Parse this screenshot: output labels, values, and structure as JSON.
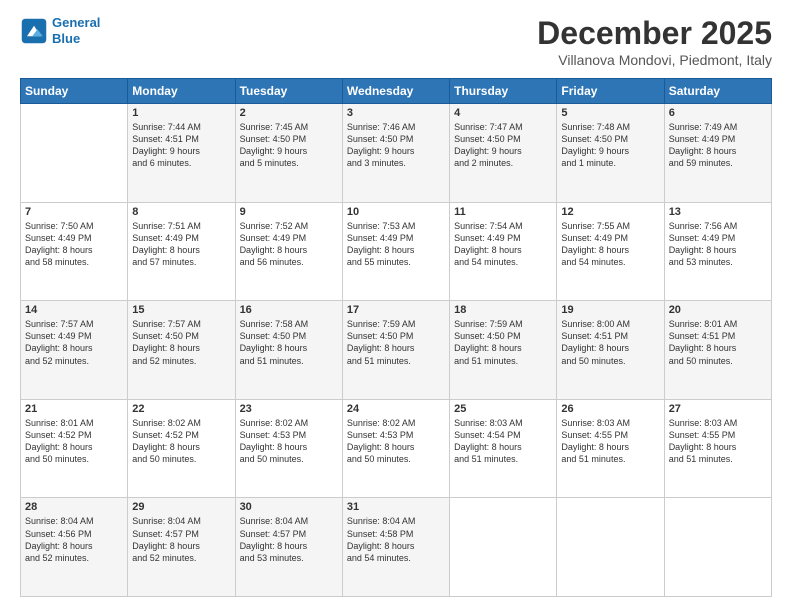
{
  "header": {
    "logo_line1": "General",
    "logo_line2": "Blue",
    "month": "December 2025",
    "location": "Villanova Mondovi, Piedmont, Italy"
  },
  "days_of_week": [
    "Sunday",
    "Monday",
    "Tuesday",
    "Wednesday",
    "Thursday",
    "Friday",
    "Saturday"
  ],
  "weeks": [
    [
      {
        "day": "",
        "content": ""
      },
      {
        "day": "1",
        "content": "Sunrise: 7:44 AM\nSunset: 4:51 PM\nDaylight: 9 hours\nand 6 minutes."
      },
      {
        "day": "2",
        "content": "Sunrise: 7:45 AM\nSunset: 4:50 PM\nDaylight: 9 hours\nand 5 minutes."
      },
      {
        "day": "3",
        "content": "Sunrise: 7:46 AM\nSunset: 4:50 PM\nDaylight: 9 hours\nand 3 minutes."
      },
      {
        "day": "4",
        "content": "Sunrise: 7:47 AM\nSunset: 4:50 PM\nDaylight: 9 hours\nand 2 minutes."
      },
      {
        "day": "5",
        "content": "Sunrise: 7:48 AM\nSunset: 4:50 PM\nDaylight: 9 hours\nand 1 minute."
      },
      {
        "day": "6",
        "content": "Sunrise: 7:49 AM\nSunset: 4:49 PM\nDaylight: 8 hours\nand 59 minutes."
      }
    ],
    [
      {
        "day": "7",
        "content": "Sunrise: 7:50 AM\nSunset: 4:49 PM\nDaylight: 8 hours\nand 58 minutes."
      },
      {
        "day": "8",
        "content": "Sunrise: 7:51 AM\nSunset: 4:49 PM\nDaylight: 8 hours\nand 57 minutes."
      },
      {
        "day": "9",
        "content": "Sunrise: 7:52 AM\nSunset: 4:49 PM\nDaylight: 8 hours\nand 56 minutes."
      },
      {
        "day": "10",
        "content": "Sunrise: 7:53 AM\nSunset: 4:49 PM\nDaylight: 8 hours\nand 55 minutes."
      },
      {
        "day": "11",
        "content": "Sunrise: 7:54 AM\nSunset: 4:49 PM\nDaylight: 8 hours\nand 54 minutes."
      },
      {
        "day": "12",
        "content": "Sunrise: 7:55 AM\nSunset: 4:49 PM\nDaylight: 8 hours\nand 54 minutes."
      },
      {
        "day": "13",
        "content": "Sunrise: 7:56 AM\nSunset: 4:49 PM\nDaylight: 8 hours\nand 53 minutes."
      }
    ],
    [
      {
        "day": "14",
        "content": "Sunrise: 7:57 AM\nSunset: 4:49 PM\nDaylight: 8 hours\nand 52 minutes."
      },
      {
        "day": "15",
        "content": "Sunrise: 7:57 AM\nSunset: 4:50 PM\nDaylight: 8 hours\nand 52 minutes."
      },
      {
        "day": "16",
        "content": "Sunrise: 7:58 AM\nSunset: 4:50 PM\nDaylight: 8 hours\nand 51 minutes."
      },
      {
        "day": "17",
        "content": "Sunrise: 7:59 AM\nSunset: 4:50 PM\nDaylight: 8 hours\nand 51 minutes."
      },
      {
        "day": "18",
        "content": "Sunrise: 7:59 AM\nSunset: 4:50 PM\nDaylight: 8 hours\nand 51 minutes."
      },
      {
        "day": "19",
        "content": "Sunrise: 8:00 AM\nSunset: 4:51 PM\nDaylight: 8 hours\nand 50 minutes."
      },
      {
        "day": "20",
        "content": "Sunrise: 8:01 AM\nSunset: 4:51 PM\nDaylight: 8 hours\nand 50 minutes."
      }
    ],
    [
      {
        "day": "21",
        "content": "Sunrise: 8:01 AM\nSunset: 4:52 PM\nDaylight: 8 hours\nand 50 minutes."
      },
      {
        "day": "22",
        "content": "Sunrise: 8:02 AM\nSunset: 4:52 PM\nDaylight: 8 hours\nand 50 minutes."
      },
      {
        "day": "23",
        "content": "Sunrise: 8:02 AM\nSunset: 4:53 PM\nDaylight: 8 hours\nand 50 minutes."
      },
      {
        "day": "24",
        "content": "Sunrise: 8:02 AM\nSunset: 4:53 PM\nDaylight: 8 hours\nand 50 minutes."
      },
      {
        "day": "25",
        "content": "Sunrise: 8:03 AM\nSunset: 4:54 PM\nDaylight: 8 hours\nand 51 minutes."
      },
      {
        "day": "26",
        "content": "Sunrise: 8:03 AM\nSunset: 4:55 PM\nDaylight: 8 hours\nand 51 minutes."
      },
      {
        "day": "27",
        "content": "Sunrise: 8:03 AM\nSunset: 4:55 PM\nDaylight: 8 hours\nand 51 minutes."
      }
    ],
    [
      {
        "day": "28",
        "content": "Sunrise: 8:04 AM\nSunset: 4:56 PM\nDaylight: 8 hours\nand 52 minutes."
      },
      {
        "day": "29",
        "content": "Sunrise: 8:04 AM\nSunset: 4:57 PM\nDaylight: 8 hours\nand 52 minutes."
      },
      {
        "day": "30",
        "content": "Sunrise: 8:04 AM\nSunset: 4:57 PM\nDaylight: 8 hours\nand 53 minutes."
      },
      {
        "day": "31",
        "content": "Sunrise: 8:04 AM\nSunset: 4:58 PM\nDaylight: 8 hours\nand 54 minutes."
      },
      {
        "day": "",
        "content": ""
      },
      {
        "day": "",
        "content": ""
      },
      {
        "day": "",
        "content": ""
      }
    ]
  ]
}
